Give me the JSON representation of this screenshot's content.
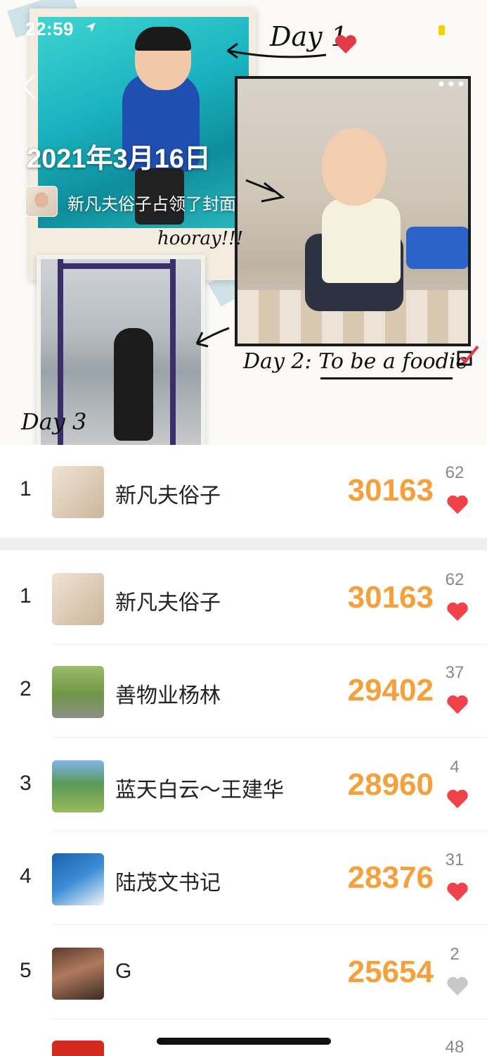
{
  "status_bar": {
    "time": "22:59"
  },
  "cover": {
    "date": "2021年3月16日",
    "owner_text": "新凡夫俗子占领了封面"
  },
  "collage_text": {
    "day1": "Day 1",
    "hooray": "hooray!!!",
    "day2": "Day 2: To be a foodie",
    "day3": "Day 3"
  },
  "my_rank": {
    "rank": "1",
    "name": "新凡夫俗子",
    "steps": "30163",
    "likes": "62",
    "liked": true
  },
  "leaderboard": [
    {
      "rank": "1",
      "name": "新凡夫俗子",
      "steps": "30163",
      "likes": "62",
      "liked": true
    },
    {
      "rank": "2",
      "name": "善物业杨林",
      "steps": "29402",
      "likes": "37",
      "liked": true
    },
    {
      "rank": "3",
      "name": "蓝天白云～王建华",
      "steps": "28960",
      "likes": "4",
      "liked": true
    },
    {
      "rank": "4",
      "name": "陆茂文书记",
      "steps": "28376",
      "likes": "31",
      "liked": true
    },
    {
      "rank": "5",
      "name": "G",
      "steps": "25654",
      "likes": "2",
      "liked": false
    },
    {
      "rank": "",
      "name": "",
      "steps": "",
      "likes": "48",
      "liked": true
    }
  ],
  "colors": {
    "steps": "#f5a03a",
    "heart_active": "#f0424a",
    "heart_inactive": "#c8c8c8"
  }
}
